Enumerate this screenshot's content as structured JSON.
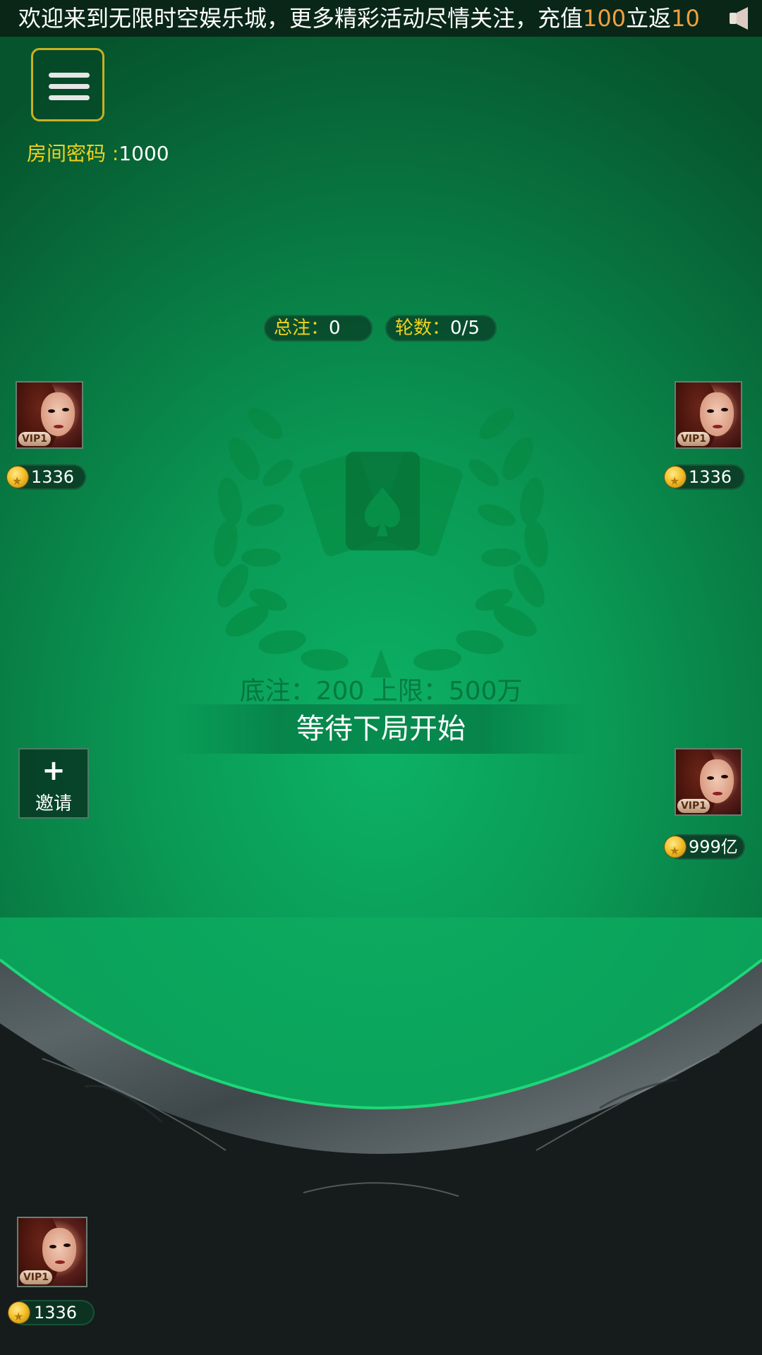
{
  "marquee": {
    "text_a": "欢迎来到无限时空娱乐城，更多精彩活动尽情关注，充值",
    "amount_a": "100",
    "text_b": "立返",
    "amount_b": "10",
    "icon": "speaker-icon"
  },
  "header": {
    "menu_icon": "menu-icon",
    "room_password_label": "房间密码 :",
    "room_password_value": "1000"
  },
  "status": {
    "total_bet_label": "总注：",
    "total_bet_value": "0",
    "rounds_label": "轮数：",
    "rounds_value": "0/5"
  },
  "table": {
    "bet_info": "底注：200   上限：500万",
    "wait_message": "等待下局开始"
  },
  "invite": {
    "label": "邀请",
    "icon": "plus-icon"
  },
  "players": [
    {
      "seat": "left-top",
      "vip": "VIP1",
      "coins": "1336"
    },
    {
      "seat": "right-top",
      "vip": "VIP1",
      "coins": "1336"
    },
    {
      "seat": "right-middle",
      "vip": "VIP1",
      "coins": "999亿"
    },
    {
      "seat": "bottom-self",
      "vip": "VIP1",
      "coins": "1336"
    }
  ],
  "colors": {
    "felt": "#0a9a56",
    "accent_gold": "#f3d21b",
    "highlight_orange": "#f0a040"
  }
}
